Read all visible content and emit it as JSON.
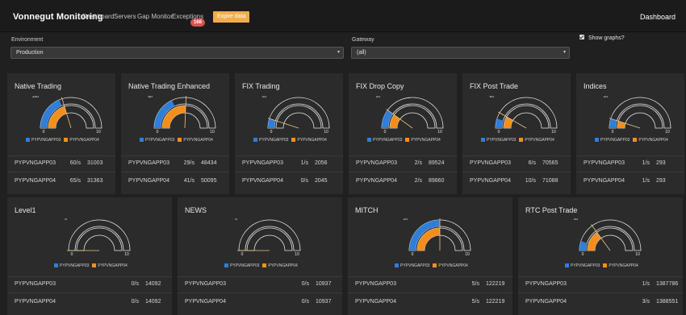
{
  "nav": {
    "brand": "Vonnegut Monitoring",
    "links": [
      "Dashboard",
      "Servers",
      "Gap Monitor",
      "Exceptions"
    ],
    "exceptions_badge": "168",
    "expire_button": "Expire data",
    "right_title": "Dashboard"
  },
  "filters": {
    "environment_label": "Environment",
    "environment_value": "Production",
    "gateway_label": "Gateway",
    "gateway_value": "(all)",
    "show_graphs_label": "Show graphs?",
    "show_graphs_checked": true
  },
  "legend": {
    "series_a": "PYPVNGAPP03",
    "series_b": "PYPVNGAPP04"
  },
  "colors": {
    "series_a": "#2f7ed8",
    "series_b": "#f28f1c",
    "badge": "#d9534f",
    "expire": "#f0ad4e"
  },
  "cards": [
    {
      "title": "Native Trading",
      "gauge_max": "160",
      "scale_min": "0",
      "scale_max": "10",
      "rows": [
        {
          "server": "PYPVNGAPP03",
          "rate": "60/s",
          "total": "31003"
        },
        {
          "server": "PYPVNGAPP04",
          "rate": "65/s",
          "total": "31363"
        }
      ]
    },
    {
      "title": "Native Trading Enhanced",
      "gauge_max": "80",
      "scale_min": "0",
      "scale_max": "10",
      "rows": [
        {
          "server": "PYPVNGAPP03",
          "rate": "29/s",
          "total": "48434"
        },
        {
          "server": "PYPVNGAPP04",
          "rate": "41/s",
          "total": "50095"
        }
      ]
    },
    {
      "title": "FIX Trading",
      "gauge_max": "10",
      "scale_min": "0",
      "scale_max": "10",
      "rows": [
        {
          "server": "PYPVNGAPP03",
          "rate": "1/s",
          "total": "2056"
        },
        {
          "server": "PYPVNGAPP04",
          "rate": "0/s",
          "total": "2045"
        }
      ]
    },
    {
      "title": "FIX Drop Copy",
      "gauge_max": "10",
      "scale_min": "0",
      "scale_max": "10",
      "rows": [
        {
          "server": "PYPVNGAPP03",
          "rate": "2/s",
          "total": "89524"
        },
        {
          "server": "PYPVNGAPP04",
          "rate": "2/s",
          "total": "89860"
        }
      ]
    },
    {
      "title": "FIX Post Trade",
      "gauge_max": "60",
      "scale_min": "0",
      "scale_max": "10",
      "rows": [
        {
          "server": "PYPVNGAPP03",
          "rate": "6/s",
          "total": "70565"
        },
        {
          "server": "PYPVNGAPP04",
          "rate": "10/s",
          "total": "71088"
        }
      ]
    },
    {
      "title": "Indices",
      "gauge_max": "10",
      "scale_min": "0",
      "scale_max": "10",
      "rows": [
        {
          "server": "PYPVNGAPP03",
          "rate": "1/s",
          "total": "293"
        },
        {
          "server": "PYPVNGAPP04",
          "rate": "1/s",
          "total": "293"
        }
      ]
    },
    {
      "title": "Level1",
      "gauge_max": "0",
      "scale_min": "0",
      "scale_max": "10",
      "rows": [
        {
          "server": "PYPVNGAPP03",
          "rate": "0/s",
          "total": "14092"
        },
        {
          "server": "PYPVNGAPP04",
          "rate": "0/s",
          "total": "14092"
        }
      ]
    },
    {
      "title": "NEWS",
      "gauge_max": "0",
      "scale_min": "0",
      "scale_max": "10",
      "rows": [
        {
          "server": "PYPVNGAPP03",
          "rate": "0/s",
          "total": "10937"
        },
        {
          "server": "PYPVNGAPP04",
          "rate": "0/s",
          "total": "10937"
        }
      ]
    },
    {
      "title": "MITCH",
      "gauge_max": "10",
      "scale_min": "0",
      "scale_max": "10",
      "rows": [
        {
          "server": "PYPVNGAPP03",
          "rate": "5/s",
          "total": "122219"
        },
        {
          "server": "PYPVNGAPP04",
          "rate": "5/s",
          "total": "122219"
        }
      ]
    },
    {
      "title": "RTC Post Trade",
      "gauge_max": "10",
      "scale_min": "0",
      "scale_max": "10",
      "rows": [
        {
          "server": "PYPVNGAPP03",
          "rate": "1/s",
          "total": "1387786"
        },
        {
          "server": "PYPVNGAPP04",
          "rate": "3/s",
          "total": "1388551"
        }
      ]
    }
  ]
}
